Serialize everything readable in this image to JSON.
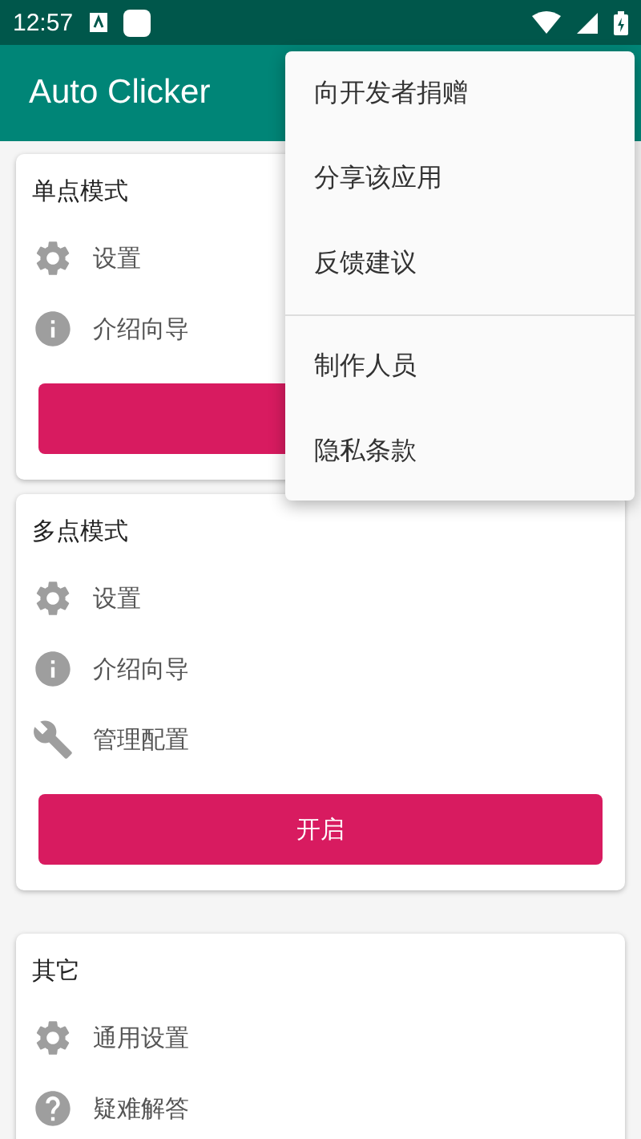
{
  "status_bar": {
    "time": "12:57"
  },
  "app_bar": {
    "title": "Auto Clicker"
  },
  "cards": [
    {
      "title": "单点模式",
      "kind": "action",
      "items": [
        {
          "kind": "gear",
          "label": "设置"
        },
        {
          "kind": "info",
          "label": "介绍向导"
        }
      ]
    },
    {
      "title": "多点模式",
      "kind": "action",
      "items": [
        {
          "kind": "gear",
          "label": "设置"
        },
        {
          "kind": "info",
          "label": "介绍向导"
        },
        {
          "kind": "wrench",
          "label": "管理配置"
        }
      ],
      "button_label": "开启"
    },
    {
      "title": "其它",
      "kind": "plain",
      "items": [
        {
          "kind": "gear",
          "label": "通用设置"
        },
        {
          "kind": "help",
          "label": "疑难解答"
        }
      ]
    }
  ],
  "menu": {
    "groups": [
      [
        "向开发者捐赠",
        "分享该应用",
        "反馈建议"
      ],
      [
        "制作人员",
        "隐私条款"
      ]
    ]
  }
}
